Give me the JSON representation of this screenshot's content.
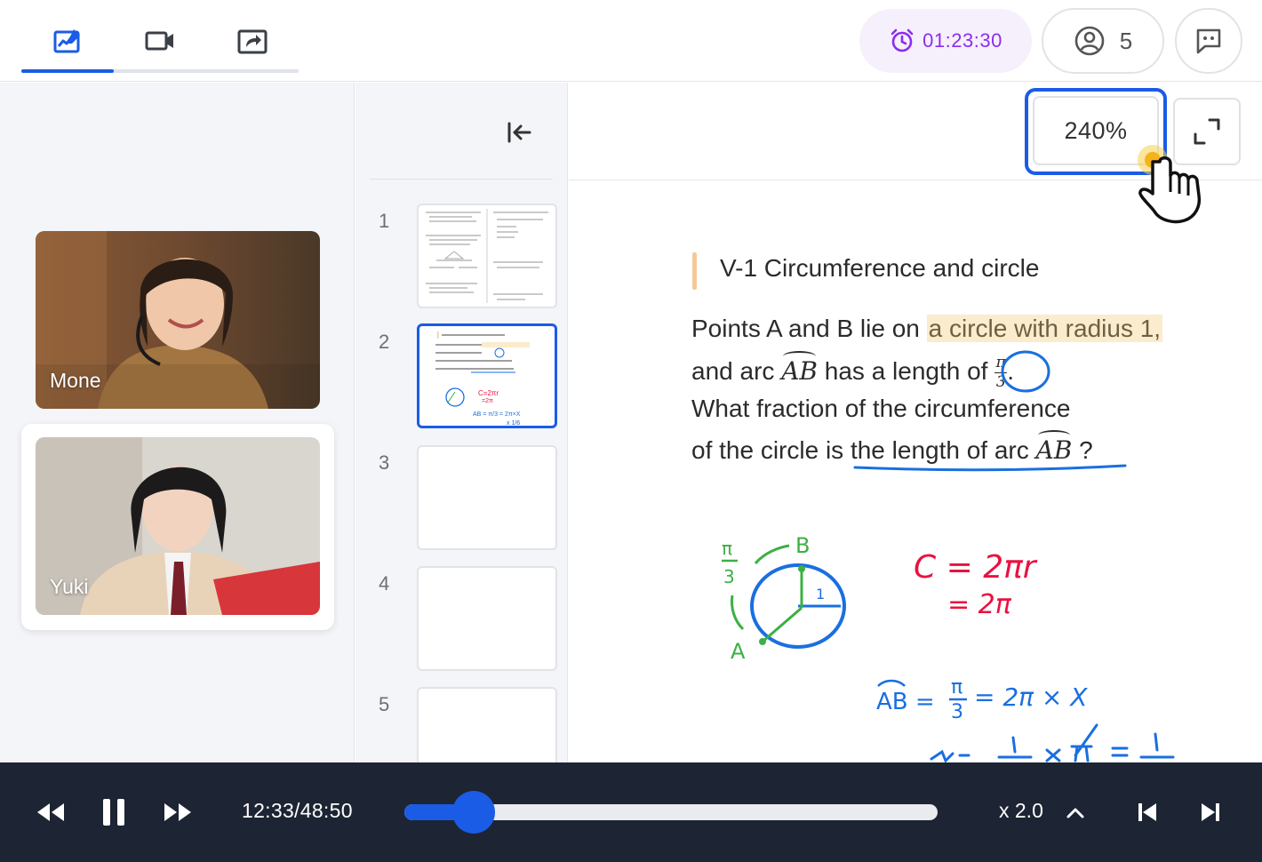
{
  "top_bar": {
    "tabs": [
      {
        "icon": "whiteboard-icon",
        "active": true
      },
      {
        "icon": "video-camera-icon",
        "active": false
      },
      {
        "icon": "share-screen-icon",
        "active": false
      }
    ],
    "timer": {
      "icon": "alarm-clock-icon",
      "value": "01:23:30"
    },
    "participants_count": {
      "icon": "user-icon",
      "value": "5"
    },
    "chat": {
      "icon": "chat-bubble-icon"
    }
  },
  "participants": [
    {
      "name": "Mone"
    },
    {
      "name": "Yuki"
    }
  ],
  "thumbnails": {
    "collapse_icon": "collapse-left-icon",
    "pages": [
      {
        "number": "1",
        "active": false
      },
      {
        "number": "2",
        "active": true
      },
      {
        "number": "3",
        "active": false
      },
      {
        "number": "4",
        "active": false
      },
      {
        "number": "5",
        "active": false
      }
    ]
  },
  "viewer": {
    "zoom": "240%",
    "expand_icon": "fullscreen-icon",
    "document": {
      "heading": "V-1 Circumference and circle",
      "line1_a": "Points A and B lie on",
      "line1_hl": "a circle with radius 1,",
      "line2_a": "and arc",
      "line2_arc": "AB",
      "line2_b": "has a length of",
      "line2_num": "π",
      "line2_den": "3",
      "line3": "What fraction of the circumference",
      "line4_a": "of the circle is the length of arc",
      "line4_arc": "AB",
      "line4_q": "?",
      "annotations": {
        "label_b": "B",
        "label_a": "A",
        "label_pi3_num": "π",
        "label_pi3_den": "3",
        "label_radius": "1",
        "formula_c1": "C = 2πr",
        "formula_c2": "= 2π",
        "formula_ab": "AB =",
        "formula_ab_rhs": "= 2π × X",
        "colors": {
          "green": "#3cb043",
          "red": "#e8123f",
          "blue": "#1a6fe0",
          "highlight": "#faeccc"
        }
      }
    }
  },
  "playback": {
    "time": "12:33/48:50",
    "progress": 0.13,
    "speed": "x 2.0",
    "icons": [
      "rewind-icon",
      "pause-icon",
      "fast-forward-icon",
      "chevron-up-icon",
      "skip-previous-icon",
      "skip-next-icon"
    ]
  }
}
